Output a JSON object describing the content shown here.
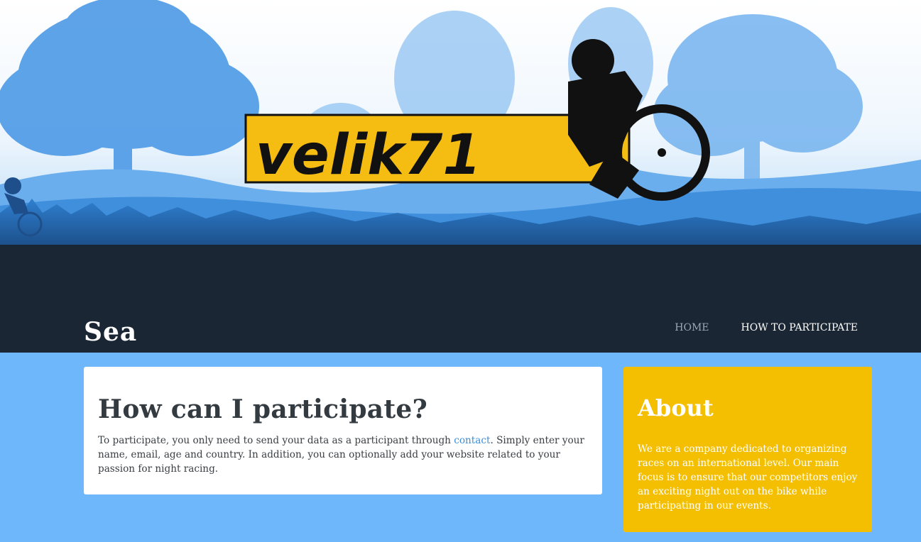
{
  "header": {
    "logo_text": "velik71",
    "site_title": "Sea"
  },
  "nav": {
    "items": [
      {
        "label": "HOME"
      },
      {
        "label": "HOW TO PARTICIPATE"
      }
    ]
  },
  "main": {
    "heading": "How can I participate?",
    "text_before_link": "To participate, you only need to send your data as a participant through ",
    "link_label": "contact",
    "text_after_link": ". Simply enter your name, email, age and country. In addition, you can optionally add your website related to your passion for night racing."
  },
  "sidebar": {
    "heading": "About",
    "text": "We are a company dedicated to organizing races on an international level. Our main focus is to ensure that our competitors enjoy an exciting night out on the bike while participating in our events."
  },
  "colors": {
    "page_background": "#6fb7fb",
    "header_dark": "#1b2634",
    "about_background": "#f3bf00",
    "link": "#3a8fd8",
    "logo_yellow": "#f5bd12"
  }
}
